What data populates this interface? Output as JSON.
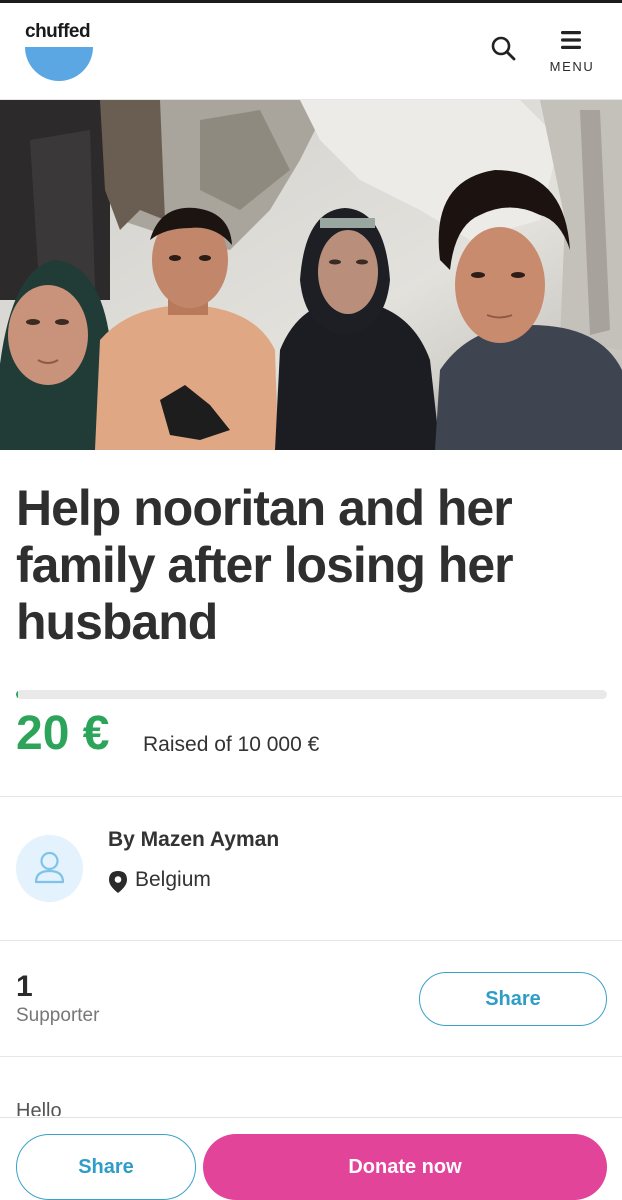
{
  "header": {
    "logo_text": "chuffed",
    "search_icon": "search-icon",
    "menu_icon": "hamburger-menu-icon",
    "menu_label": "MENU"
  },
  "hero": {
    "image_alt": "Family photo",
    "depicts": "four people sitting in front of a damaged wall"
  },
  "campaign": {
    "title": "Help nooritan and her family after losing her husband",
    "raised_amount": "20 €",
    "raised_label": "Raised of 10 000 €",
    "progress_fraction": 0.002
  },
  "organiser": {
    "avatar_icon": "user-icon",
    "name": "By Mazen Ayman",
    "location_icon": "map-pin-icon",
    "location": "Belgium"
  },
  "supporters": {
    "count": "1",
    "label": "Supporter",
    "share_label": "Share"
  },
  "story": {
    "partial_text": "Hello"
  },
  "footer": {
    "share_label": "Share",
    "donate_label": "Donate now"
  },
  "colors": {
    "brand_blue": "#5aa7e3",
    "raised_green": "#2ca55a",
    "donate_pink": "#e2449a",
    "share_blue": "#2f9dc8"
  }
}
